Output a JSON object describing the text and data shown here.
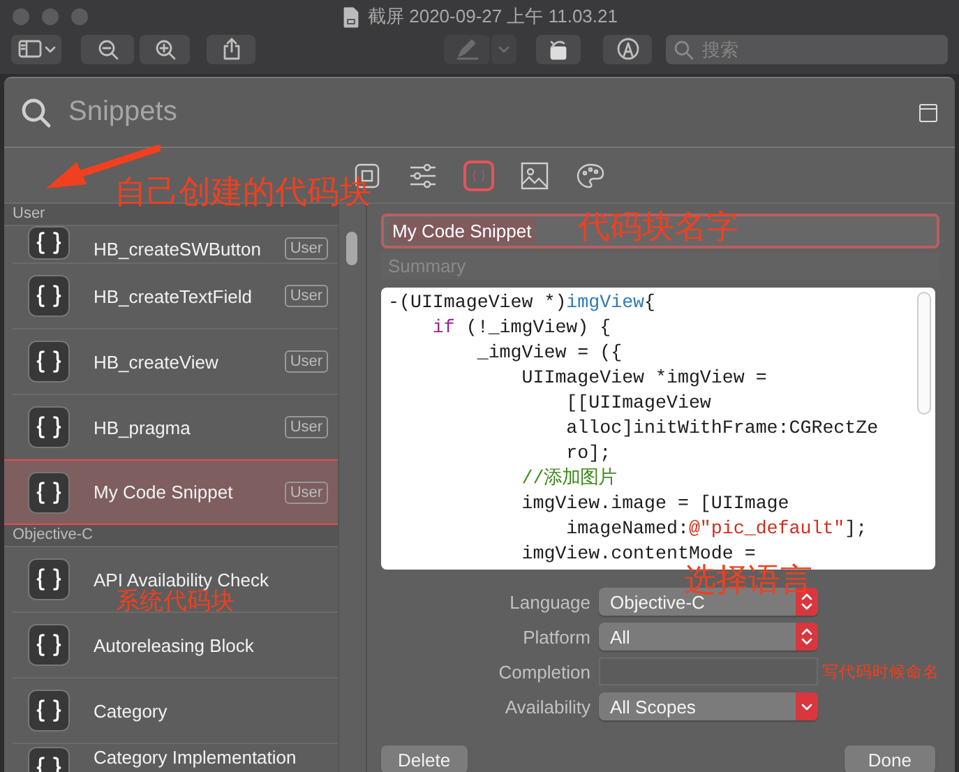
{
  "window": {
    "title": "截屏 2020-09-27 上午 11.03.21"
  },
  "toolbar": {
    "search": {
      "placeholder": "搜索"
    }
  },
  "library": {
    "search": {
      "placeholder": "Snippets"
    },
    "tabs": [
      {
        "kind": "square",
        "selected": false
      },
      {
        "kind": "sliders",
        "selected": false
      },
      {
        "kind": "braces",
        "selected": true
      },
      {
        "kind": "image",
        "selected": false
      },
      {
        "kind": "palette",
        "selected": false
      }
    ],
    "sections": [
      {
        "title": "User",
        "items": [
          {
            "name": "HB_createSWButton",
            "badge": "User",
            "selected": false
          },
          {
            "name": "HB_createTextField",
            "badge": "User",
            "selected": false
          },
          {
            "name": "HB_createView",
            "badge": "User",
            "selected": false
          },
          {
            "name": "HB_pragma",
            "badge": "User",
            "selected": false
          },
          {
            "name": "My Code Snippet",
            "badge": "User",
            "selected": true
          }
        ]
      },
      {
        "title": "Objective-C",
        "items": [
          {
            "name": "API Availability Check",
            "selected": false
          },
          {
            "name": "Autoreleasing Block",
            "selected": false
          },
          {
            "name": "Category",
            "selected": false
          },
          {
            "name": "Category Implementation",
            "selected": false
          }
        ]
      }
    ]
  },
  "editor": {
    "title": "My Code Snippet",
    "summary": {
      "placeholder": "Summary"
    },
    "code": [
      [
        {
          "kind": "plain",
          "text": "-(UIImageView *)"
        },
        {
          "kind": "method",
          "text": "imgView"
        },
        {
          "kind": "plain",
          "text": "{"
        }
      ],
      [
        {
          "kind": "keyword",
          "text": "    if"
        },
        {
          "kind": "plain",
          "text": " (!_imgView) {"
        }
      ],
      [
        {
          "kind": "plain",
          "text": "        _imgView = ({"
        }
      ],
      [
        {
          "kind": "plain",
          "text": "            UIImageView *imgView ="
        }
      ],
      [
        {
          "kind": "plain",
          "text": "                [[UIImageView"
        }
      ],
      [
        {
          "kind": "plain",
          "text": "                alloc]initWithFrame:CGRectZe"
        }
      ],
      [
        {
          "kind": "plain",
          "text": "                ro];"
        }
      ],
      [
        {
          "kind": "comment",
          "text": "            //添加图片"
        }
      ],
      [
        {
          "kind": "plain",
          "text": "            imgView.image = [UIImage"
        }
      ],
      [
        {
          "kind": "plain",
          "text": "                imageNamed:"
        },
        {
          "kind": "string",
          "text": "@\"pic_default\""
        },
        {
          "kind": "plain",
          "text": "];"
        }
      ],
      [
        {
          "kind": "plain",
          "text": "            imgView.contentMode ="
        }
      ]
    ],
    "fields": [
      {
        "kind": "popup",
        "label": "Language",
        "value": "Objective-C"
      },
      {
        "kind": "popup",
        "label": "Platform",
        "value": "All"
      },
      {
        "kind": "text",
        "label": "Completion"
      },
      {
        "kind": "pulldown",
        "label": "Availability",
        "value": "All Scopes"
      }
    ],
    "buttons": [
      "Delete",
      "Done"
    ]
  },
  "annotations": [
    {
      "text": "自己创建的代码块"
    },
    {
      "text": "代码块名字"
    },
    {
      "text": "系统代码块"
    },
    {
      "text": "选择语言"
    },
    {
      "text": "写代码时候命名"
    }
  ]
}
